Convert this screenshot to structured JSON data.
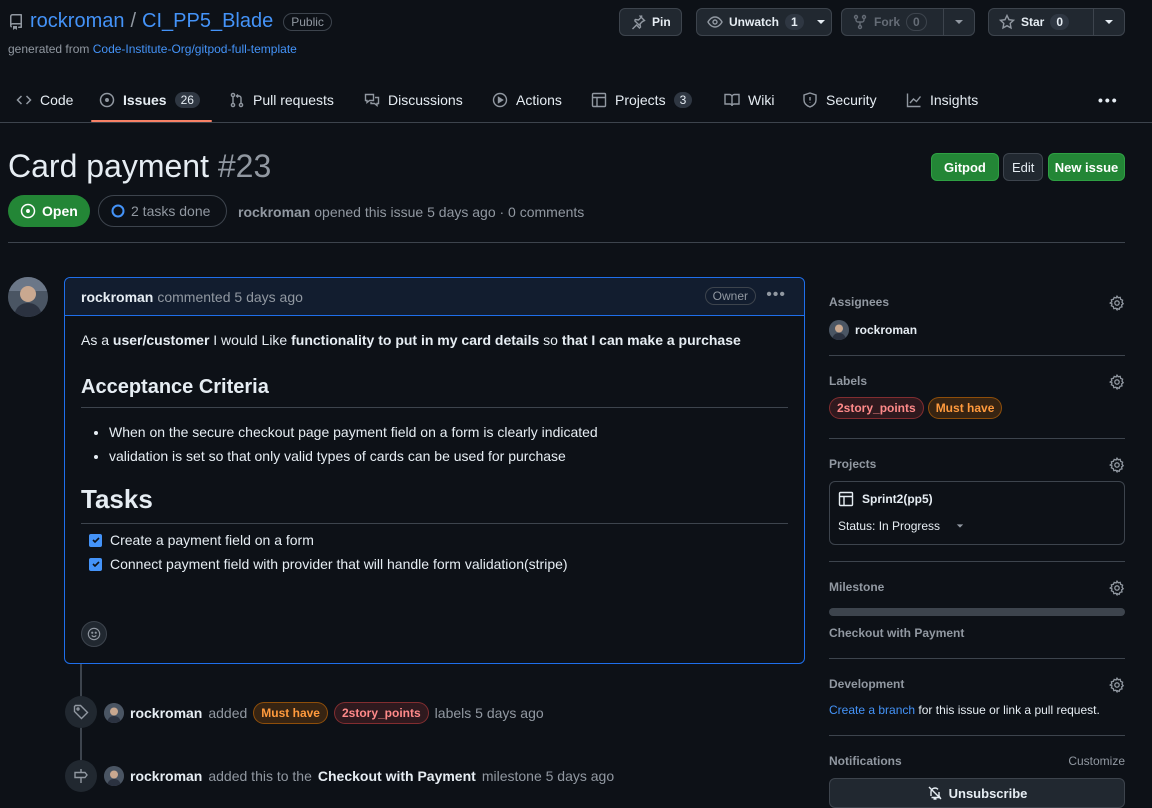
{
  "repo": {
    "owner": "rockroman",
    "separator": "/",
    "name": "CI_PP5_Blade",
    "visibility": "Public",
    "generated_prefix": "generated from",
    "template": "Code-Institute-Org/gitpod-full-template"
  },
  "header_buttons": {
    "pin": "Pin",
    "unwatch": "Unwatch",
    "unwatch_count": "1",
    "fork": "Fork",
    "fork_count": "0",
    "star": "Star",
    "star_count": "0"
  },
  "tabs": [
    {
      "label": "Code",
      "icon": "code-icon"
    },
    {
      "label": "Issues",
      "icon": "issue-opened-icon",
      "count": "26",
      "selected": true
    },
    {
      "label": "Pull requests",
      "icon": "git-pull-request-icon"
    },
    {
      "label": "Discussions",
      "icon": "comment-discussion-icon"
    },
    {
      "label": "Actions",
      "icon": "play-icon"
    },
    {
      "label": "Projects",
      "icon": "table-icon",
      "count": "3"
    },
    {
      "label": "Wiki",
      "icon": "book-icon"
    },
    {
      "label": "Security",
      "icon": "shield-icon"
    },
    {
      "label": "Insights",
      "icon": "graph-icon"
    }
  ],
  "issue": {
    "title": "Card payment",
    "number": "#23",
    "state": "Open",
    "tasks_done": "2 tasks done",
    "author": "rockroman",
    "opened_text": "opened this issue 5 days ago · 0 comments",
    "buttons": {
      "gitpod": "Gitpod",
      "edit": "Edit",
      "new_issue": "New issue"
    }
  },
  "comment": {
    "author": "rockroman",
    "when": "commented 5 days ago",
    "role_badge": "Owner",
    "story": {
      "t1": "As a ",
      "b1": "user/customer",
      "t2": " I would Like ",
      "b2": "functionality to put in my card details",
      "t3": " so ",
      "b3": "that I can make a purchase"
    },
    "acceptance_heading": "Acceptance Criteria",
    "criteria": [
      "When on the secure checkout page payment field on a form is clearly indicated",
      "validation is set so that only valid types of cards can be used for purchase"
    ],
    "tasks_heading": "Tasks",
    "tasks": [
      {
        "label": "Create a payment field on a form",
        "checked": true
      },
      {
        "label": "Connect payment field with provider that will handle form validation(stripe)",
        "checked": true
      }
    ]
  },
  "timeline": [
    {
      "author": "rockroman",
      "action": "added",
      "labels": [
        "Must have",
        "2story_points"
      ],
      "suffix": "labels 5 days ago",
      "icon": "tag-icon"
    },
    {
      "author": "rockroman",
      "action": "added this to the",
      "milestone": "Checkout with Payment",
      "suffix": "milestone 5 days ago",
      "icon": "milestone-icon"
    }
  ],
  "sidebar": {
    "assignees": {
      "title": "Assignees",
      "user": "rockroman"
    },
    "labels": {
      "title": "Labels",
      "items": [
        "2story_points",
        "Must have"
      ]
    },
    "projects": {
      "title": "Projects",
      "name": "Sprint2(pp5)",
      "status": "Status: In Progress"
    },
    "milestone": {
      "title": "Milestone",
      "name": "Checkout with Payment",
      "progress": 0
    },
    "development": {
      "title": "Development",
      "link": "Create a branch",
      "text": " for this issue or link a pull request."
    },
    "notifications": {
      "title": "Notifications",
      "customize": "Customize",
      "button": "Unsubscribe"
    }
  },
  "colors": {
    "background": "#0d1117",
    "accent_link": "#4493f8",
    "open_green": "#238636",
    "selected_tab_underline": "#f78166",
    "comment_border": "#1f6feb"
  }
}
